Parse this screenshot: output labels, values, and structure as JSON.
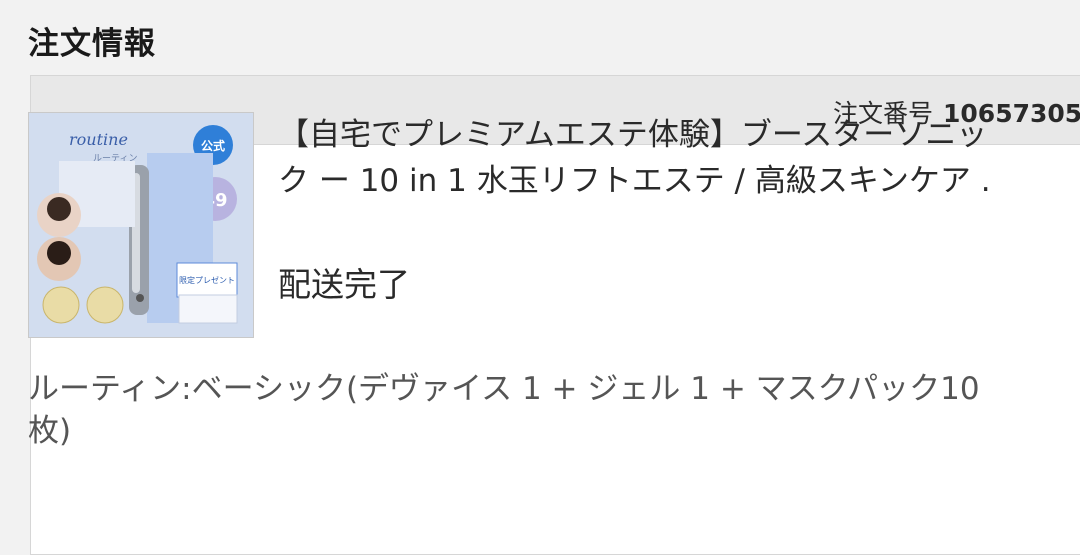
{
  "page": {
    "section_title": "注文情報"
  },
  "order": {
    "number_label": "注文番号",
    "number_value": "10657305"
  },
  "product": {
    "title_line1": "【自宅でプレミアムエステ体験】ブースターソニッ",
    "title_line2": "ク ー 10 in 1 水玉リフトエステ / 高級スキンケア .",
    "status": "配送完了",
    "variant_line1": "ルーティン:ベーシック(デヴァイス 1 + ジェル 1 + マスクパック10",
    "variant_line2": "枚)",
    "image_text": {
      "brand": "routine",
      "brand_sub": "ルーティン",
      "badge_official": "公式",
      "badge_price": "49",
      "gift_label": "限定プレゼント"
    }
  },
  "colors": {
    "page_bg": "#f2f2f2",
    "header_bg": "#e8e8e8",
    "card_bg": "#ffffff",
    "image_bg": "#d2ddef",
    "badge_blue": "#2f7fd8"
  }
}
